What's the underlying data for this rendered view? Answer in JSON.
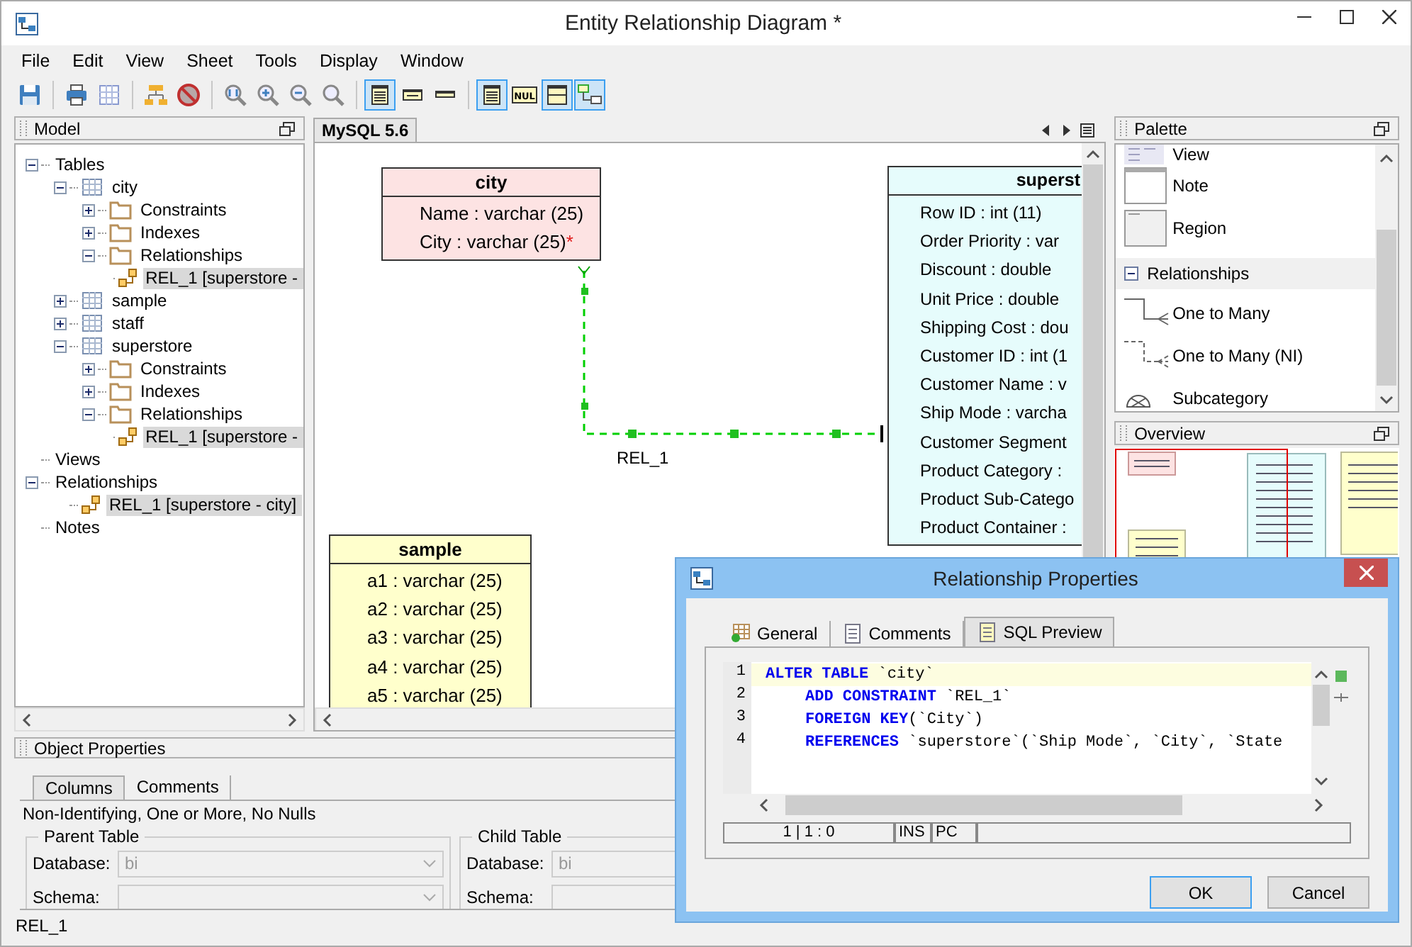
{
  "window": {
    "title": "Entity Relationship Diagram *"
  },
  "menu": [
    "File",
    "Edit",
    "View",
    "Sheet",
    "Tools",
    "Display",
    "Window"
  ],
  "toolbar": [
    [
      {
        "kind": "floppy",
        "selected": false
      }
    ],
    [
      {
        "kind": "printer",
        "selected": false
      },
      {
        "kind": "grid",
        "selected": false
      }
    ],
    [
      {
        "kind": "hierarchy",
        "selected": false
      },
      {
        "kind": "forbidden",
        "selected": false
      }
    ],
    [
      {
        "kind": "zoom-fit",
        "selected": false
      },
      {
        "kind": "zoom-in",
        "selected": false
      },
      {
        "kind": "zoom-out",
        "selected": false
      },
      {
        "kind": "zoom",
        "selected": false
      }
    ],
    [
      {
        "kind": "table-full",
        "selected": true
      },
      {
        "kind": "table-keys",
        "selected": false
      },
      {
        "kind": "table-name",
        "selected": false
      }
    ],
    [
      {
        "kind": "table-lines",
        "selected": true
      },
      {
        "kind": "null-badge",
        "label": "NUL",
        "selected": false
      },
      {
        "kind": "table-blank",
        "selected": true
      },
      {
        "kind": "diagram",
        "selected": true
      }
    ]
  ],
  "model_panel": {
    "title": "Model",
    "tree": [
      {
        "label": "Tables",
        "expanded": true,
        "selected": false,
        "children": [
          {
            "label": "city",
            "kind": "table",
            "expanded": true,
            "selected": false,
            "children": [
              {
                "label": "Constraints",
                "kind": "folder",
                "expanded": false,
                "selected": false
              },
              {
                "label": "Indexes",
                "kind": "folder",
                "expanded": false,
                "selected": false
              },
              {
                "label": "Relationships",
                "kind": "folder",
                "expanded": true,
                "selected": false,
                "children": [
                  {
                    "label": "REL_1 [superstore -",
                    "kind": "relationship",
                    "selected": true
                  }
                ]
              }
            ]
          },
          {
            "label": "sample",
            "kind": "table",
            "expanded": false,
            "selected": false
          },
          {
            "label": "staff",
            "kind": "table",
            "expanded": false,
            "selected": false
          },
          {
            "label": "superstore",
            "kind": "table",
            "expanded": true,
            "selected": false,
            "children": [
              {
                "label": "Constraints",
                "kind": "folder",
                "expanded": false,
                "selected": false
              },
              {
                "label": "Indexes",
                "kind": "folder",
                "expanded": false,
                "selected": false
              },
              {
                "label": "Relationships",
                "kind": "folder",
                "expanded": true,
                "selected": false,
                "children": [
                  {
                    "label": "REL_1 [superstore -",
                    "kind": "relationship",
                    "selected": true
                  }
                ]
              }
            ]
          }
        ]
      },
      {
        "label": "Views",
        "selected": false
      },
      {
        "label": "Relationships",
        "expanded": true,
        "selected": false,
        "children": [
          {
            "label": "REL_1 [superstore - city]",
            "kind": "relationship",
            "selected": true
          }
        ]
      },
      {
        "label": "Notes",
        "selected": false
      }
    ]
  },
  "editor_tab": {
    "label": "MySQL 5.6"
  },
  "canvas": {
    "entities": [
      {
        "name": "city",
        "color": "#fde3e3",
        "fields": [
          {
            "text": "Name : varchar (25)"
          },
          {
            "text": "City : varchar (25)",
            "mark": "*"
          }
        ]
      },
      {
        "name": "sample",
        "color": "#ffffcc",
        "fields": [
          {
            "text": "a1 : varchar (25)"
          },
          {
            "text": "a2 : varchar (25)"
          },
          {
            "text": "a3 : varchar (25)"
          },
          {
            "text": "a4 : varchar (25)"
          },
          {
            "text": "a5 : varchar (25)"
          }
        ]
      },
      {
        "name": "superst",
        "color": "#e6fcfc",
        "fields": [
          {
            "text": "Row ID : int (11)"
          },
          {
            "text": "Order Priority : var"
          },
          {
            "text": "Discount : double"
          },
          {
            "text": "Unit Price : double"
          },
          {
            "text": "Shipping Cost : dou"
          },
          {
            "text": "Customer ID : int (1"
          },
          {
            "text": "Customer Name : v"
          },
          {
            "text": "Ship Mode : varcha"
          },
          {
            "text": "Customer Segment"
          },
          {
            "text": "Product Category :"
          },
          {
            "text": "Product Sub-Catego"
          },
          {
            "text": "Product Container :"
          }
        ]
      }
    ],
    "relationships": [
      {
        "label": "REL_1"
      }
    ]
  },
  "palette": {
    "title": "Palette",
    "items": [
      {
        "label": "View",
        "kind": "view"
      },
      {
        "label": "Note",
        "kind": "note"
      },
      {
        "label": "Region",
        "kind": "region"
      },
      {
        "label": "Relationships",
        "kind": "group",
        "expanded": true
      },
      {
        "label": "One to Many",
        "kind": "one-to-many"
      },
      {
        "label": "One to Many (NI)",
        "kind": "one-to-many-ni"
      },
      {
        "label": "Subcategory",
        "kind": "subcategory"
      }
    ]
  },
  "overview": {
    "title": "Overview"
  },
  "object_properties": {
    "title": "Object Properties",
    "tabs": [
      {
        "label": "Columns",
        "selected": true
      },
      {
        "label": "Comments",
        "selected": false
      }
    ],
    "description": "Non-Identifying, One or More, No Nulls",
    "groups": [
      {
        "title": "Parent Table",
        "fields": [
          {
            "label": "Database:",
            "value": "bi"
          },
          {
            "label": "Schema:"
          }
        ]
      },
      {
        "title": "Child Table",
        "fields": [
          {
            "label": "Database:",
            "value": "bi"
          },
          {
            "label": "Schema:"
          }
        ]
      }
    ]
  },
  "status_bar": "REL_1",
  "dialog": {
    "title": "Relationship Properties",
    "tabs": [
      {
        "label": "General",
        "selected": false
      },
      {
        "label": "Comments",
        "selected": false
      },
      {
        "label": "SQL Preview",
        "selected": true
      }
    ],
    "code": [
      {
        "number": "1",
        "current": true,
        "indent": false,
        "tokens": [
          {
            "kind": "keyword",
            "text": "ALTER TABLE"
          },
          {
            "kind": "text",
            "text": " `city`"
          }
        ]
      },
      {
        "number": "2",
        "current": false,
        "indent": true,
        "tokens": [
          {
            "kind": "keyword",
            "text": "ADD CONSTRAINT"
          },
          {
            "kind": "text",
            "text": " `REL_1`"
          }
        ]
      },
      {
        "number": "3",
        "current": false,
        "indent": true,
        "tokens": [
          {
            "kind": "keyword",
            "text": "FOREIGN KEY"
          },
          {
            "kind": "text",
            "text": "(`City`)"
          }
        ]
      },
      {
        "number": "4",
        "current": false,
        "indent": true,
        "tokens": [
          {
            "kind": "keyword",
            "text": "REFERENCES"
          },
          {
            "kind": "text",
            "text": " `superstore`(`Ship Mode`, `City`, `State"
          }
        ]
      }
    ],
    "editor_status": [
      "1 | 1 : 0",
      "INS",
      "PC"
    ],
    "buttons": [
      {
        "label": "OK",
        "default": true
      },
      {
        "label": "Cancel",
        "default": false
      }
    ]
  }
}
